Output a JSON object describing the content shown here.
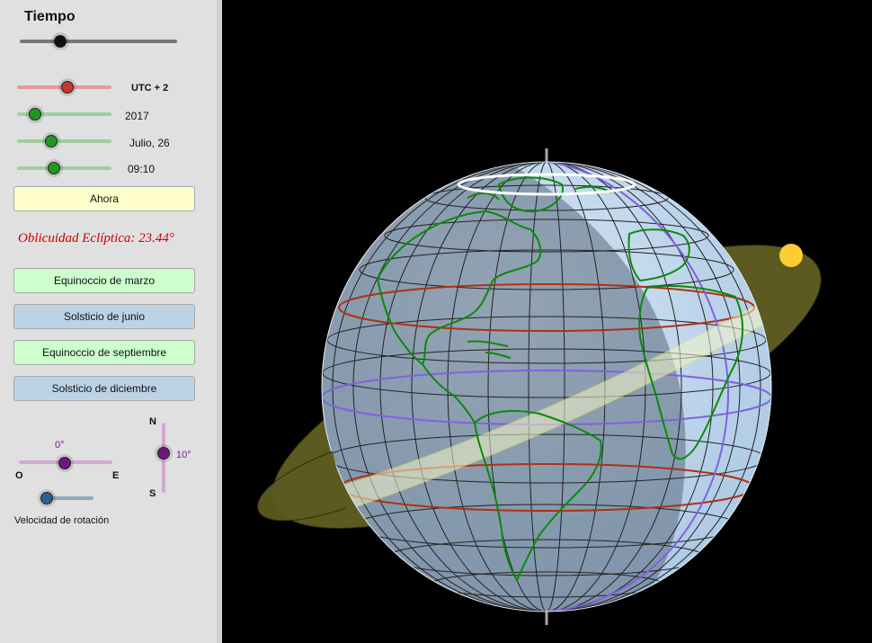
{
  "panel": {
    "time_title": "Tiempo",
    "timezone_label": "UTC + 2",
    "year_label": "2017",
    "date_label": "Julio, 26",
    "time_label": "09:10",
    "now_button": "Ahora",
    "obliquity_text": "Oblicuidad Eclíptica: 23.44°",
    "buttons": [
      {
        "label": "Equinoccio de marzo"
      },
      {
        "label": "Solsticio de junio"
      },
      {
        "label": "Equinoccio de septiembre"
      },
      {
        "label": "Solsticio de diciembre"
      }
    ],
    "horiz_angle": "0°",
    "west": "O",
    "east": "E",
    "north": "N",
    "south": "S",
    "vert_angle": "10°",
    "rotation_speed_label": "Velocidad de rotación"
  },
  "colors": {
    "timezone_slider": "#e07070",
    "green_slider": "#5aaa5a",
    "tilt_slider": "#b57ab5",
    "speed_slider": "#3f6f9f",
    "tropic": "#b03010",
    "equator": "#8060e0",
    "continents": "#0a8a0a",
    "sun": "#ffcc33",
    "ecliptic_plane": "#5c5a20"
  }
}
